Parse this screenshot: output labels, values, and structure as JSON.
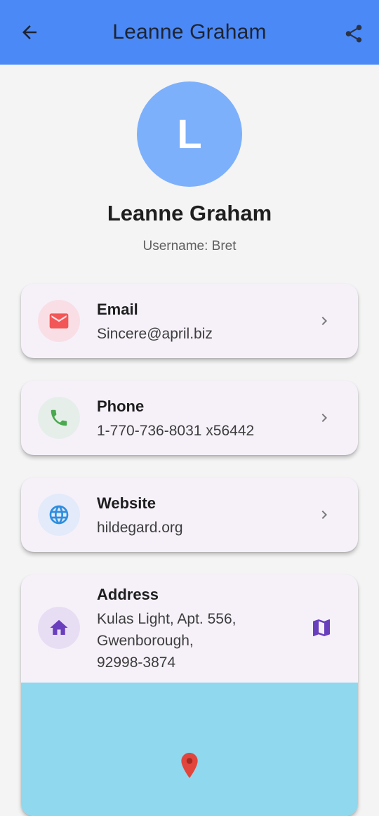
{
  "appbar": {
    "title": "Leanne Graham",
    "back_icon": "arrow-back-icon",
    "share_icon": "share-icon",
    "color": "#4b89f6"
  },
  "profile": {
    "initial": "L",
    "name": "Leanne Graham",
    "username": "Username: Bret",
    "avatar_color": "#7db0fb"
  },
  "contacts": {
    "email": {
      "label": "Email",
      "value": "Sincere@april.biz",
      "icon": "email-icon",
      "icon_color": "#f25656",
      "icon_bg": "#f9dfe5"
    },
    "phone": {
      "label": "Phone",
      "value": "1-770-736-8031 x56442",
      "icon": "phone-icon",
      "icon_color": "#4aa94e",
      "icon_bg": "#e6eeea"
    },
    "website": {
      "label": "Website",
      "value": "hildegard.org",
      "icon": "globe-icon",
      "icon_color": "#2d8ee0",
      "icon_bg": "#e3eafa"
    },
    "address": {
      "label": "Address",
      "line1": "Kulas Light, Apt. 556,",
      "line2": "Gwenborough,",
      "line3": "92998-3874",
      "icon": "home-icon",
      "icon_color": "#6a3fbd",
      "icon_bg": "#e8def4",
      "action_icon": "map-icon"
    }
  },
  "map": {
    "color": "#8fd8ee",
    "pin_icon": "location-pin-icon",
    "pin_color": "#e2453c"
  }
}
